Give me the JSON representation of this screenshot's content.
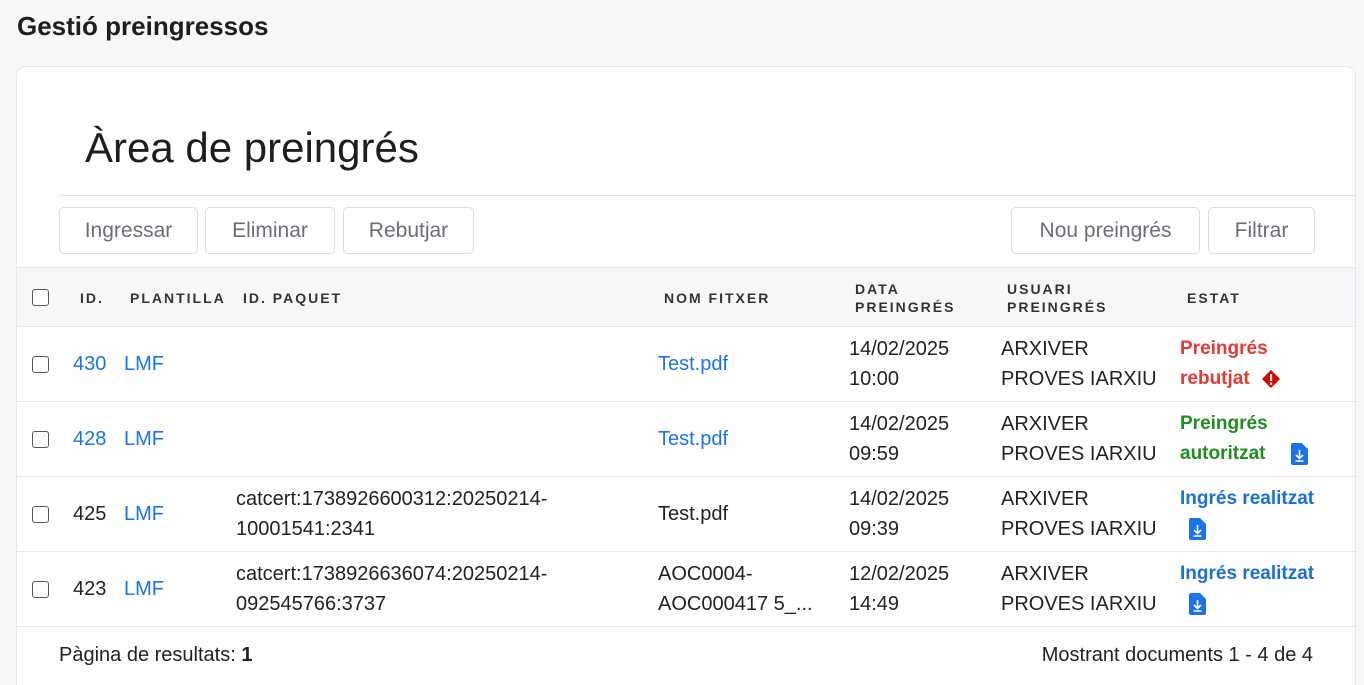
{
  "page": {
    "title": "Gestió preingressos"
  },
  "area": {
    "title": "Àrea de preingrés"
  },
  "toolbar": {
    "ingressar": "Ingressar",
    "eliminar": "Eliminar",
    "rebutjar": "Rebutjar",
    "nou": "Nou preingrés",
    "filtrar": "Filtrar"
  },
  "table": {
    "headers": {
      "id": "ID.",
      "plantilla": "PLANTILLA",
      "paquet": "ID. PAQUET",
      "fitxer": "NOM FITXER",
      "data_1": "DATA",
      "data_2": "PREINGRÉS",
      "usuari_1": "USUARI",
      "usuari_2": "PREINGRÉS",
      "estat": "ESTAT"
    },
    "rows": [
      {
        "id": "430",
        "plantilla": "LMF",
        "paquet_1": "",
        "paquet_2": "",
        "fitxer_1": "Test.pdf",
        "fitxer_2": "",
        "data_1": "14/02/2025",
        "data_2": "10:00",
        "usuari_1": "ARXIVER",
        "usuari_2": "PROVES IARXIU",
        "estat_1": "Preingrés",
        "estat_2": "rebutjat",
        "icon": "warning-icon"
      },
      {
        "id": "428",
        "plantilla": "LMF",
        "paquet_1": "",
        "paquet_2": "",
        "fitxer_1": "Test.pdf",
        "fitxer_2": "",
        "data_1": "14/02/2025",
        "data_2": "09:59",
        "usuari_1": "ARXIVER",
        "usuari_2": "PROVES IARXIU",
        "estat_1": "Preingrés",
        "estat_2": "autoritzat",
        "icon": "download-document-icon"
      },
      {
        "id": "425",
        "plantilla": "LMF",
        "paquet_1": "catcert:1738926600312:20250214-",
        "paquet_2": "10001541:2341",
        "fitxer_1": "Test.pdf",
        "fitxer_2": "",
        "data_1": "14/02/2025",
        "data_2": "09:39",
        "usuari_1": "ARXIVER",
        "usuari_2": "PROVES IARXIU",
        "estat_1": "Ingrés realitzat",
        "estat_2": "",
        "icon": "download-document-icon"
      },
      {
        "id": "423",
        "plantilla": "LMF",
        "paquet_1": "catcert:1738926636074:20250214-",
        "paquet_2": "092545766:3737",
        "fitxer_1": "AOC0004-",
        "fitxer_2": "AOC000417 5_...",
        "data_1": "12/02/2025",
        "data_2": "14:49",
        "usuari_1": "ARXIVER",
        "usuari_2": "PROVES IARXIU",
        "estat_1": "Ingrés realitzat",
        "estat_2": "",
        "icon": "download-document-icon"
      }
    ]
  },
  "footer": {
    "page_label": "Pàgina de resultats:",
    "page_number": "1",
    "showing": "Mostrant documents 1 - 4 de 4"
  },
  "colors": {
    "link": "#1a73e8",
    "rejected": "#e53935",
    "authorized": "#1e8e1e",
    "done": "#1a6fd6",
    "warning": "#d50000"
  }
}
